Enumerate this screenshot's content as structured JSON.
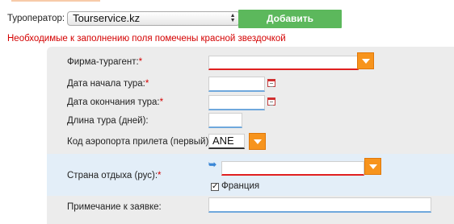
{
  "operator": {
    "label": "Туроператор:",
    "selected": "Tourservice.kz"
  },
  "add_button": {
    "label": "Добавить"
  },
  "required_note": "Необходимые к заполнению поля помечены красной звездочкой",
  "form": {
    "agent_firm": {
      "label": "Фирма-турагент:",
      "star": "*"
    },
    "tour_start": {
      "label": "Дата начала тура:",
      "star": "*"
    },
    "tour_end": {
      "label": "Дата окончания тура:",
      "star": "*"
    },
    "tour_length": {
      "label": "Длина тура (дней):"
    },
    "airport_code": {
      "label": "Код аэропорта прилета (первый):",
      "star": "*",
      "value": "ANE"
    },
    "country": {
      "label": "Страна отдыха (рус):",
      "star": "*",
      "checkbox_label": "Франция",
      "checkbox_checked": true
    },
    "note": {
      "label": "Примечание к заявке:"
    }
  },
  "colors": {
    "accent_green": "#5cb85c",
    "dropdown_orange": "#f7941d",
    "required_red": "#d40000",
    "panel_bg": "#ececec",
    "highlight_bg": "#e3eef8"
  }
}
